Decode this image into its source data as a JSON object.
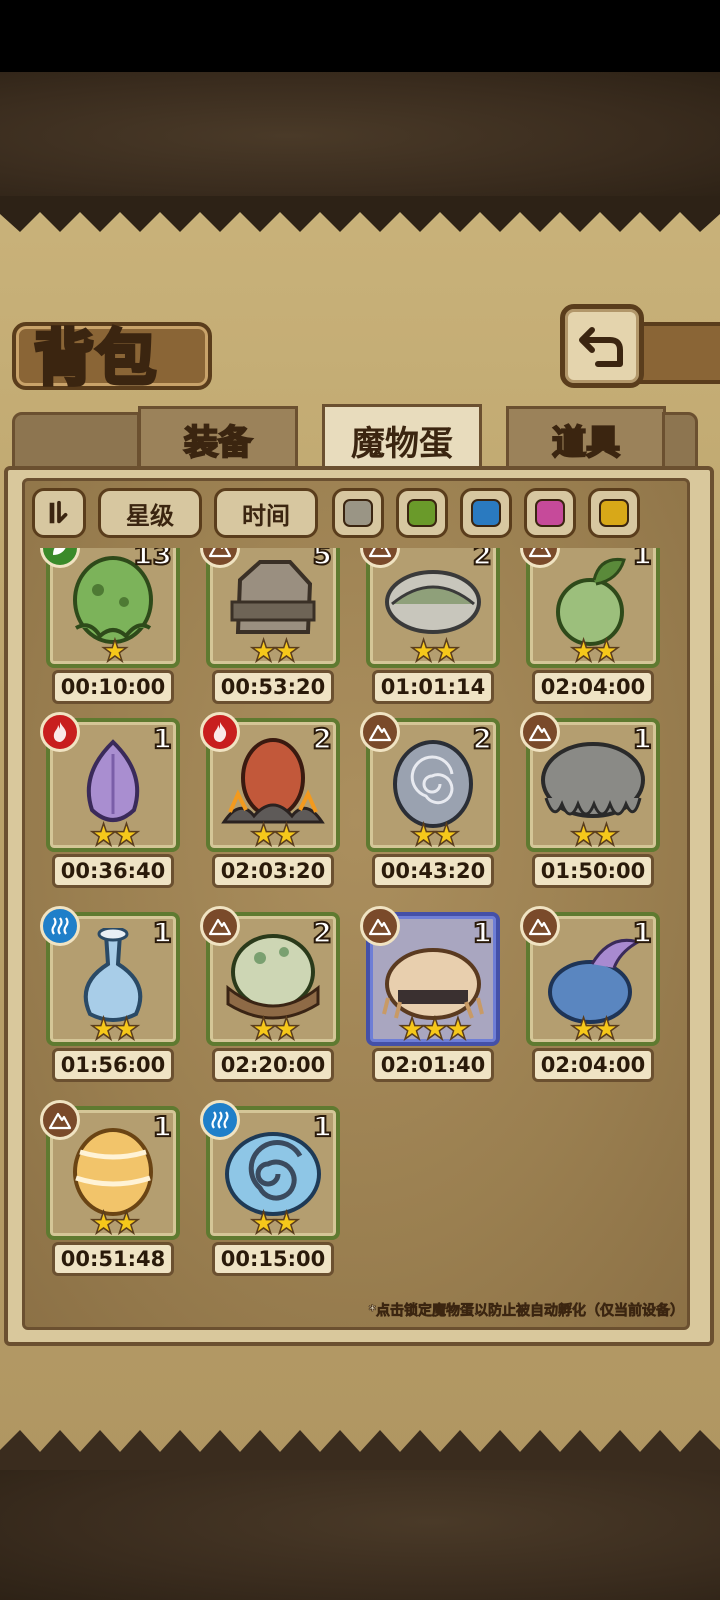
{
  "title": "背包",
  "tabs": [
    {
      "label": "装备",
      "active": false
    },
    {
      "label": "魔物蛋",
      "active": true
    },
    {
      "label": "道具",
      "active": false
    }
  ],
  "filters": {
    "sort_icon": "sort-icon",
    "star_label": "星级",
    "time_label": "时间",
    "colors": [
      "#9a9585",
      "#6a9a2a",
      "#2a7ac0",
      "#c64a9a",
      "#d8a818"
    ]
  },
  "eggs": [
    {
      "name": "green-slime-egg",
      "count": "13",
      "stars": "★",
      "timer": "00:10:00",
      "element": "nature",
      "art": "slime"
    },
    {
      "name": "rock-egg",
      "count": "5",
      "stars": "★★",
      "timer": "00:53:20",
      "element": "earth",
      "art": "rock"
    },
    {
      "name": "shell-egg",
      "count": "2",
      "stars": "★★",
      "timer": "01:01:14",
      "element": "earth",
      "art": "shell"
    },
    {
      "name": "sprout-egg",
      "count": "1",
      "stars": "★★",
      "timer": "02:04:00",
      "element": "earth",
      "art": "sprout"
    },
    {
      "name": "purple-flower-egg",
      "count": "1",
      "stars": "★★",
      "timer": "00:36:40",
      "element": "fire",
      "art": "flower"
    },
    {
      "name": "lava-egg",
      "count": "2",
      "stars": "★★",
      "timer": "02:03:20",
      "element": "fire",
      "art": "lava"
    },
    {
      "name": "spiral-stone-egg",
      "count": "2",
      "stars": "★★",
      "timer": "00:43:20",
      "element": "earth",
      "art": "spiral"
    },
    {
      "name": "fur-egg",
      "count": "1",
      "stars": "★★",
      "timer": "01:50:00",
      "element": "earth",
      "art": "fur"
    },
    {
      "name": "bottle-egg",
      "count": "1",
      "stars": "★★",
      "timer": "01:56:00",
      "element": "water",
      "art": "bottle"
    },
    {
      "name": "dino-egg",
      "count": "2",
      "stars": "★★",
      "timer": "02:20:00",
      "element": "earth",
      "art": "dino"
    },
    {
      "name": "straw-egg",
      "count": "1",
      "stars": "★★★",
      "timer": "02:01:40",
      "element": "earth",
      "art": "straw",
      "selected": true
    },
    {
      "name": "fin-egg",
      "count": "1",
      "stars": "★★",
      "timer": "02:04:00",
      "element": "earth",
      "art": "fin"
    },
    {
      "name": "golden-egg",
      "count": "1",
      "stars": "★★",
      "timer": "00:51:48",
      "element": "earth",
      "art": "golden"
    },
    {
      "name": "snail-egg",
      "count": "1",
      "stars": "★★",
      "timer": "00:15:00",
      "element": "water",
      "art": "snail"
    }
  ],
  "hint": "*点击锁定魔物蛋以防止被自动孵化（仅当前设备）"
}
